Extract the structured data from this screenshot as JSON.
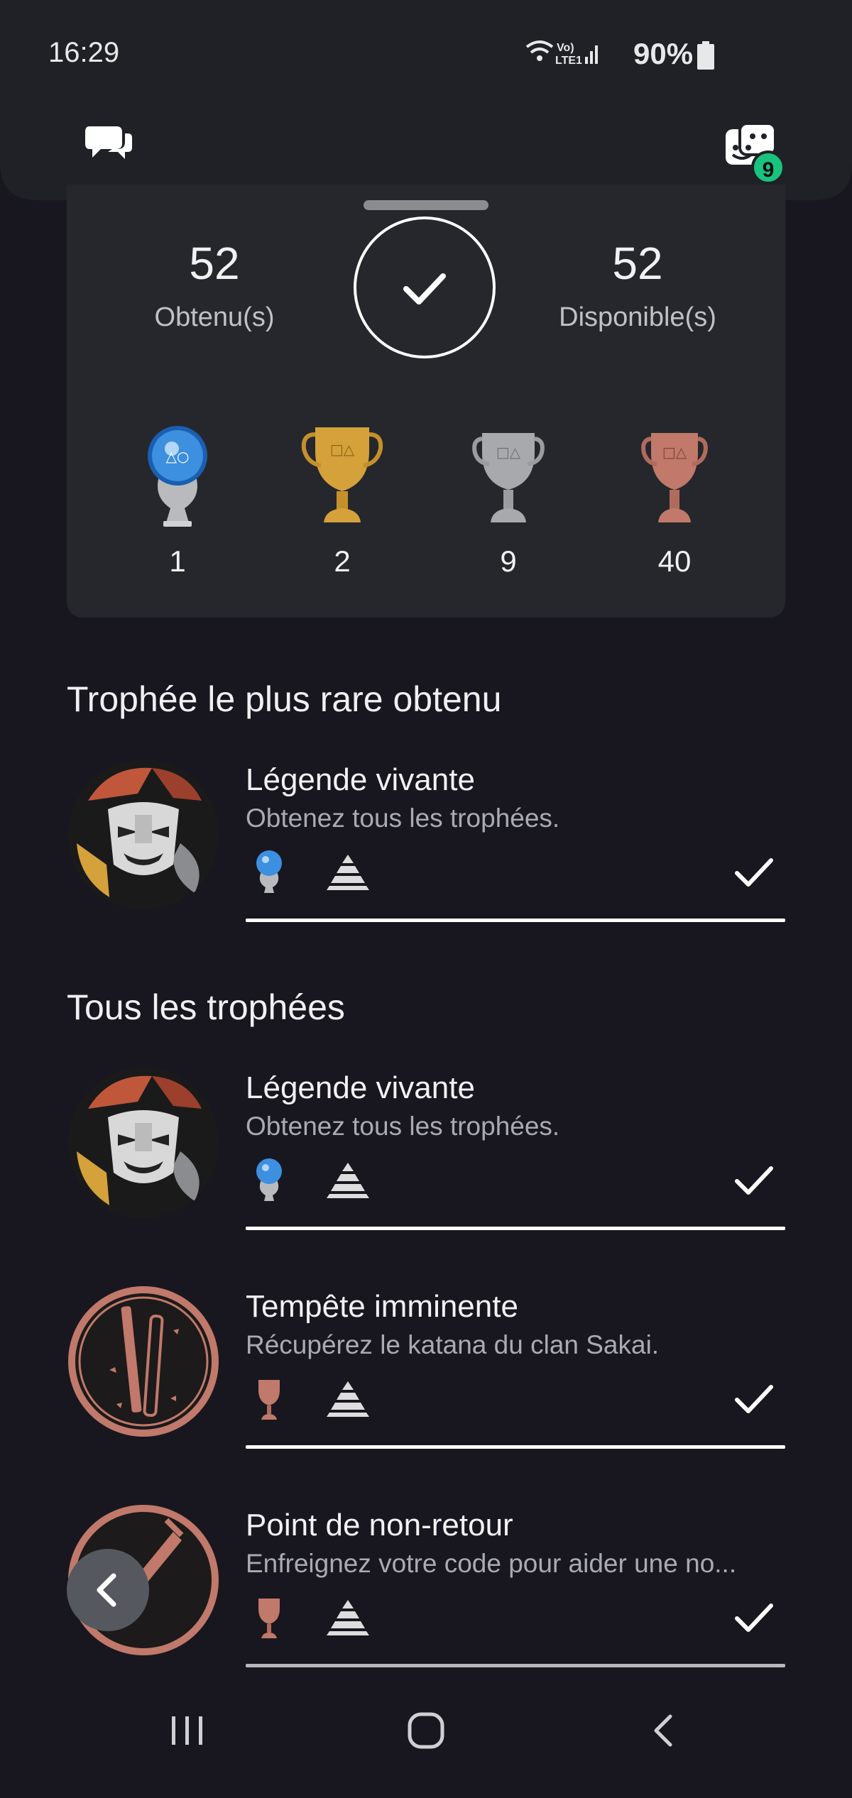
{
  "status": {
    "time": "16:29",
    "battery": "90%"
  },
  "friends": {
    "badge": "9"
  },
  "summary": {
    "earned_value": "52",
    "earned_label": "Obtenu(s)",
    "available_value": "52",
    "available_label": "Disponible(s)",
    "trophies": [
      {
        "grade": "platinum",
        "count": "1"
      },
      {
        "grade": "gold",
        "count": "2"
      },
      {
        "grade": "silver",
        "count": "9"
      },
      {
        "grade": "bronze",
        "count": "40"
      }
    ]
  },
  "rarest": {
    "title": "Trophée le plus rare obtenu",
    "item": {
      "name": "Légende vivante",
      "description": "Obtenez tous les trophées.",
      "grade": "platinum"
    }
  },
  "all": {
    "title": "Tous les trophées",
    "items": [
      {
        "name": "Légende vivante",
        "description": "Obtenez tous les trophées.",
        "grade": "platinum"
      },
      {
        "name": "Tempête imminente",
        "description": "Récupérez le katana du clan Sakai.",
        "grade": "bronze"
      },
      {
        "name": "Point de non-retour",
        "description": "Enfreignez votre code pour aider une no...",
        "grade": "bronze"
      }
    ]
  },
  "colors": {
    "background": "#18171f",
    "card": "#25272c",
    "accent_green": "#19c37d",
    "platinum": "#9fd3f0",
    "gold": "#d4a13a",
    "silver": "#b8babd",
    "bronze": "#c0796a"
  },
  "icons": [
    "chat-icon",
    "friends-icon",
    "check-icon",
    "trophy-icon",
    "rarity-pyramid-icon",
    "back-arrow-icon",
    "recents-icon",
    "home-icon",
    "nav-back-icon"
  ]
}
